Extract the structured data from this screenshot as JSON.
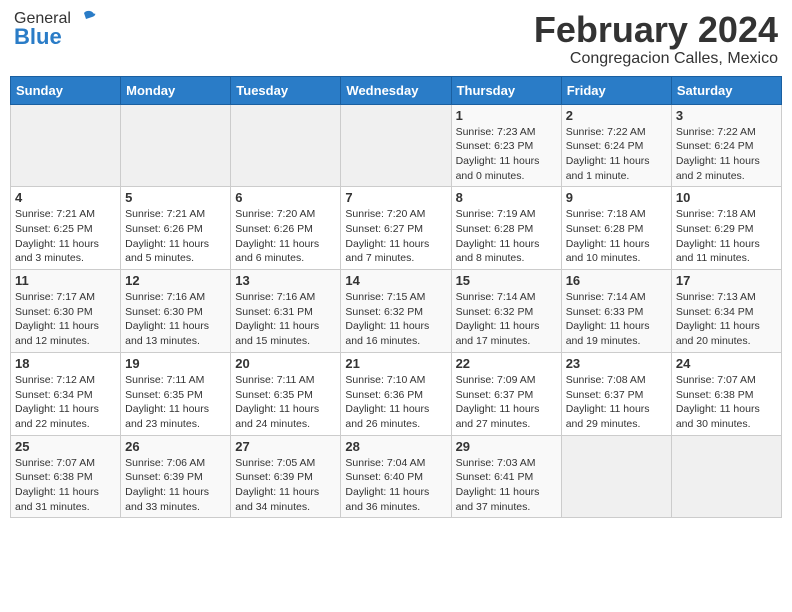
{
  "header": {
    "logo_general": "General",
    "logo_blue": "Blue",
    "title": "February 2024",
    "subtitle": "Congregacion Calles, Mexico"
  },
  "days_of_week": [
    "Sunday",
    "Monday",
    "Tuesday",
    "Wednesday",
    "Thursday",
    "Friday",
    "Saturday"
  ],
  "weeks": [
    [
      {
        "day": "",
        "info": ""
      },
      {
        "day": "",
        "info": ""
      },
      {
        "day": "",
        "info": ""
      },
      {
        "day": "",
        "info": ""
      },
      {
        "day": "1",
        "info": "Sunrise: 7:23 AM\nSunset: 6:23 PM\nDaylight: 11 hours\nand 0 minutes."
      },
      {
        "day": "2",
        "info": "Sunrise: 7:22 AM\nSunset: 6:24 PM\nDaylight: 11 hours\nand 1 minute."
      },
      {
        "day": "3",
        "info": "Sunrise: 7:22 AM\nSunset: 6:24 PM\nDaylight: 11 hours\nand 2 minutes."
      }
    ],
    [
      {
        "day": "4",
        "info": "Sunrise: 7:21 AM\nSunset: 6:25 PM\nDaylight: 11 hours\nand 3 minutes."
      },
      {
        "day": "5",
        "info": "Sunrise: 7:21 AM\nSunset: 6:26 PM\nDaylight: 11 hours\nand 5 minutes."
      },
      {
        "day": "6",
        "info": "Sunrise: 7:20 AM\nSunset: 6:26 PM\nDaylight: 11 hours\nand 6 minutes."
      },
      {
        "day": "7",
        "info": "Sunrise: 7:20 AM\nSunset: 6:27 PM\nDaylight: 11 hours\nand 7 minutes."
      },
      {
        "day": "8",
        "info": "Sunrise: 7:19 AM\nSunset: 6:28 PM\nDaylight: 11 hours\nand 8 minutes."
      },
      {
        "day": "9",
        "info": "Sunrise: 7:18 AM\nSunset: 6:28 PM\nDaylight: 11 hours\nand 10 minutes."
      },
      {
        "day": "10",
        "info": "Sunrise: 7:18 AM\nSunset: 6:29 PM\nDaylight: 11 hours\nand 11 minutes."
      }
    ],
    [
      {
        "day": "11",
        "info": "Sunrise: 7:17 AM\nSunset: 6:30 PM\nDaylight: 11 hours\nand 12 minutes."
      },
      {
        "day": "12",
        "info": "Sunrise: 7:16 AM\nSunset: 6:30 PM\nDaylight: 11 hours\nand 13 minutes."
      },
      {
        "day": "13",
        "info": "Sunrise: 7:16 AM\nSunset: 6:31 PM\nDaylight: 11 hours\nand 15 minutes."
      },
      {
        "day": "14",
        "info": "Sunrise: 7:15 AM\nSunset: 6:32 PM\nDaylight: 11 hours\nand 16 minutes."
      },
      {
        "day": "15",
        "info": "Sunrise: 7:14 AM\nSunset: 6:32 PM\nDaylight: 11 hours\nand 17 minutes."
      },
      {
        "day": "16",
        "info": "Sunrise: 7:14 AM\nSunset: 6:33 PM\nDaylight: 11 hours\nand 19 minutes."
      },
      {
        "day": "17",
        "info": "Sunrise: 7:13 AM\nSunset: 6:34 PM\nDaylight: 11 hours\nand 20 minutes."
      }
    ],
    [
      {
        "day": "18",
        "info": "Sunrise: 7:12 AM\nSunset: 6:34 PM\nDaylight: 11 hours\nand 22 minutes."
      },
      {
        "day": "19",
        "info": "Sunrise: 7:11 AM\nSunset: 6:35 PM\nDaylight: 11 hours\nand 23 minutes."
      },
      {
        "day": "20",
        "info": "Sunrise: 7:11 AM\nSunset: 6:35 PM\nDaylight: 11 hours\nand 24 minutes."
      },
      {
        "day": "21",
        "info": "Sunrise: 7:10 AM\nSunset: 6:36 PM\nDaylight: 11 hours\nand 26 minutes."
      },
      {
        "day": "22",
        "info": "Sunrise: 7:09 AM\nSunset: 6:37 PM\nDaylight: 11 hours\nand 27 minutes."
      },
      {
        "day": "23",
        "info": "Sunrise: 7:08 AM\nSunset: 6:37 PM\nDaylight: 11 hours\nand 29 minutes."
      },
      {
        "day": "24",
        "info": "Sunrise: 7:07 AM\nSunset: 6:38 PM\nDaylight: 11 hours\nand 30 minutes."
      }
    ],
    [
      {
        "day": "25",
        "info": "Sunrise: 7:07 AM\nSunset: 6:38 PM\nDaylight: 11 hours\nand 31 minutes."
      },
      {
        "day": "26",
        "info": "Sunrise: 7:06 AM\nSunset: 6:39 PM\nDaylight: 11 hours\nand 33 minutes."
      },
      {
        "day": "27",
        "info": "Sunrise: 7:05 AM\nSunset: 6:39 PM\nDaylight: 11 hours\nand 34 minutes."
      },
      {
        "day": "28",
        "info": "Sunrise: 7:04 AM\nSunset: 6:40 PM\nDaylight: 11 hours\nand 36 minutes."
      },
      {
        "day": "29",
        "info": "Sunrise: 7:03 AM\nSunset: 6:41 PM\nDaylight: 11 hours\nand 37 minutes."
      },
      {
        "day": "",
        "info": ""
      },
      {
        "day": "",
        "info": ""
      }
    ]
  ]
}
